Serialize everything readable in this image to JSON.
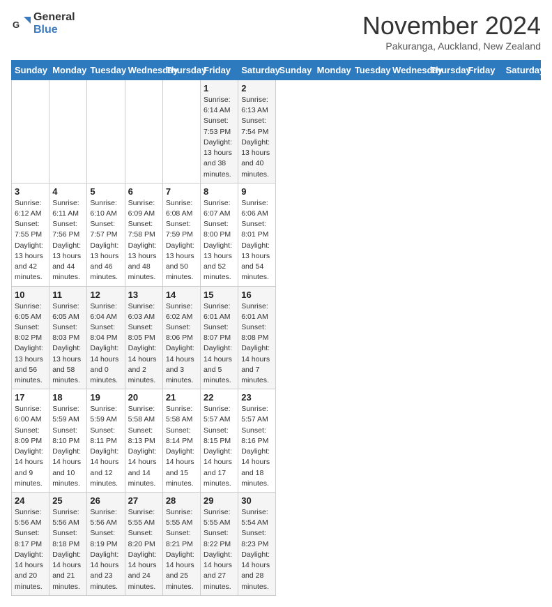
{
  "logo": {
    "general": "General",
    "blue": "Blue"
  },
  "header": {
    "month": "November 2024",
    "location": "Pakuranga, Auckland, New Zealand"
  },
  "days_of_week": [
    "Sunday",
    "Monday",
    "Tuesday",
    "Wednesday",
    "Thursday",
    "Friday",
    "Saturday"
  ],
  "weeks": [
    [
      {
        "day": "",
        "info": ""
      },
      {
        "day": "",
        "info": ""
      },
      {
        "day": "",
        "info": ""
      },
      {
        "day": "",
        "info": ""
      },
      {
        "day": "",
        "info": ""
      },
      {
        "day": "1",
        "info": "Sunrise: 6:14 AM\nSunset: 7:53 PM\nDaylight: 13 hours and 38 minutes."
      },
      {
        "day": "2",
        "info": "Sunrise: 6:13 AM\nSunset: 7:54 PM\nDaylight: 13 hours and 40 minutes."
      }
    ],
    [
      {
        "day": "3",
        "info": "Sunrise: 6:12 AM\nSunset: 7:55 PM\nDaylight: 13 hours and 42 minutes."
      },
      {
        "day": "4",
        "info": "Sunrise: 6:11 AM\nSunset: 7:56 PM\nDaylight: 13 hours and 44 minutes."
      },
      {
        "day": "5",
        "info": "Sunrise: 6:10 AM\nSunset: 7:57 PM\nDaylight: 13 hours and 46 minutes."
      },
      {
        "day": "6",
        "info": "Sunrise: 6:09 AM\nSunset: 7:58 PM\nDaylight: 13 hours and 48 minutes."
      },
      {
        "day": "7",
        "info": "Sunrise: 6:08 AM\nSunset: 7:59 PM\nDaylight: 13 hours and 50 minutes."
      },
      {
        "day": "8",
        "info": "Sunrise: 6:07 AM\nSunset: 8:00 PM\nDaylight: 13 hours and 52 minutes."
      },
      {
        "day": "9",
        "info": "Sunrise: 6:06 AM\nSunset: 8:01 PM\nDaylight: 13 hours and 54 minutes."
      }
    ],
    [
      {
        "day": "10",
        "info": "Sunrise: 6:05 AM\nSunset: 8:02 PM\nDaylight: 13 hours and 56 minutes."
      },
      {
        "day": "11",
        "info": "Sunrise: 6:05 AM\nSunset: 8:03 PM\nDaylight: 13 hours and 58 minutes."
      },
      {
        "day": "12",
        "info": "Sunrise: 6:04 AM\nSunset: 8:04 PM\nDaylight: 14 hours and 0 minutes."
      },
      {
        "day": "13",
        "info": "Sunrise: 6:03 AM\nSunset: 8:05 PM\nDaylight: 14 hours and 2 minutes."
      },
      {
        "day": "14",
        "info": "Sunrise: 6:02 AM\nSunset: 8:06 PM\nDaylight: 14 hours and 3 minutes."
      },
      {
        "day": "15",
        "info": "Sunrise: 6:01 AM\nSunset: 8:07 PM\nDaylight: 14 hours and 5 minutes."
      },
      {
        "day": "16",
        "info": "Sunrise: 6:01 AM\nSunset: 8:08 PM\nDaylight: 14 hours and 7 minutes."
      }
    ],
    [
      {
        "day": "17",
        "info": "Sunrise: 6:00 AM\nSunset: 8:09 PM\nDaylight: 14 hours and 9 minutes."
      },
      {
        "day": "18",
        "info": "Sunrise: 5:59 AM\nSunset: 8:10 PM\nDaylight: 14 hours and 10 minutes."
      },
      {
        "day": "19",
        "info": "Sunrise: 5:59 AM\nSunset: 8:11 PM\nDaylight: 14 hours and 12 minutes."
      },
      {
        "day": "20",
        "info": "Sunrise: 5:58 AM\nSunset: 8:13 PM\nDaylight: 14 hours and 14 minutes."
      },
      {
        "day": "21",
        "info": "Sunrise: 5:58 AM\nSunset: 8:14 PM\nDaylight: 14 hours and 15 minutes."
      },
      {
        "day": "22",
        "info": "Sunrise: 5:57 AM\nSunset: 8:15 PM\nDaylight: 14 hours and 17 minutes."
      },
      {
        "day": "23",
        "info": "Sunrise: 5:57 AM\nSunset: 8:16 PM\nDaylight: 14 hours and 18 minutes."
      }
    ],
    [
      {
        "day": "24",
        "info": "Sunrise: 5:56 AM\nSunset: 8:17 PM\nDaylight: 14 hours and 20 minutes."
      },
      {
        "day": "25",
        "info": "Sunrise: 5:56 AM\nSunset: 8:18 PM\nDaylight: 14 hours and 21 minutes."
      },
      {
        "day": "26",
        "info": "Sunrise: 5:56 AM\nSunset: 8:19 PM\nDaylight: 14 hours and 23 minutes."
      },
      {
        "day": "27",
        "info": "Sunrise: 5:55 AM\nSunset: 8:20 PM\nDaylight: 14 hours and 24 minutes."
      },
      {
        "day": "28",
        "info": "Sunrise: 5:55 AM\nSunset: 8:21 PM\nDaylight: 14 hours and 25 minutes."
      },
      {
        "day": "29",
        "info": "Sunrise: 5:55 AM\nSunset: 8:22 PM\nDaylight: 14 hours and 27 minutes."
      },
      {
        "day": "30",
        "info": "Sunrise: 5:54 AM\nSunset: 8:23 PM\nDaylight: 14 hours and 28 minutes."
      }
    ]
  ]
}
